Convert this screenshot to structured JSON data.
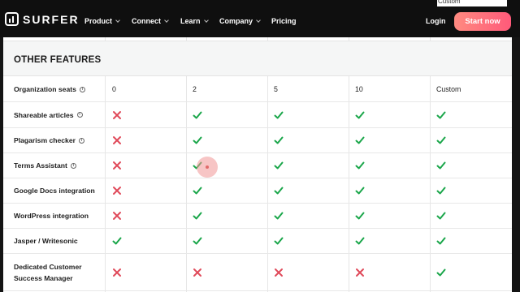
{
  "nav": {
    "logo": "SURFER",
    "items": [
      {
        "label": "Product",
        "dropdown": true
      },
      {
        "label": "Connect",
        "dropdown": true
      },
      {
        "label": "Learn",
        "dropdown": true
      },
      {
        "label": "Company",
        "dropdown": true
      },
      {
        "label": "Pricing",
        "dropdown": false
      }
    ],
    "login": "Login",
    "cta": "Start now",
    "peek_text": "Custom"
  },
  "section": {
    "title": "OTHER FEATURES"
  },
  "colors": {
    "check": "#1aa64a",
    "cross": "#e04a5a",
    "cta_from": "#ff8a80",
    "cta_to": "#ff5a7a"
  },
  "rows": [
    {
      "feature": "Organization seats",
      "info": true,
      "values": [
        "0",
        "2",
        "5",
        "10",
        "Custom"
      ]
    },
    {
      "feature": "Shareable articles",
      "info": true,
      "values": [
        "cross",
        "check",
        "check",
        "check",
        "check"
      ]
    },
    {
      "feature": "Plagarism checker",
      "info": true,
      "values": [
        "cross",
        "check",
        "check",
        "check",
        "check"
      ]
    },
    {
      "feature": "Terms Assistant",
      "info": true,
      "values": [
        "cross",
        "check",
        "check",
        "check",
        "check"
      ]
    },
    {
      "feature": "Google Docs integration",
      "info": false,
      "values": [
        "cross",
        "check",
        "check",
        "check",
        "check"
      ]
    },
    {
      "feature": "WordPress integration",
      "info": false,
      "values": [
        "cross",
        "check",
        "check",
        "check",
        "check"
      ]
    },
    {
      "feature": "Jasper / Writesonic",
      "info": false,
      "values": [
        "check",
        "check",
        "check",
        "check",
        "check"
      ]
    },
    {
      "feature": "Dedicated Customer Success Manager",
      "info": false,
      "values": [
        "cross",
        "cross",
        "cross",
        "cross",
        "check"
      ]
    }
  ]
}
